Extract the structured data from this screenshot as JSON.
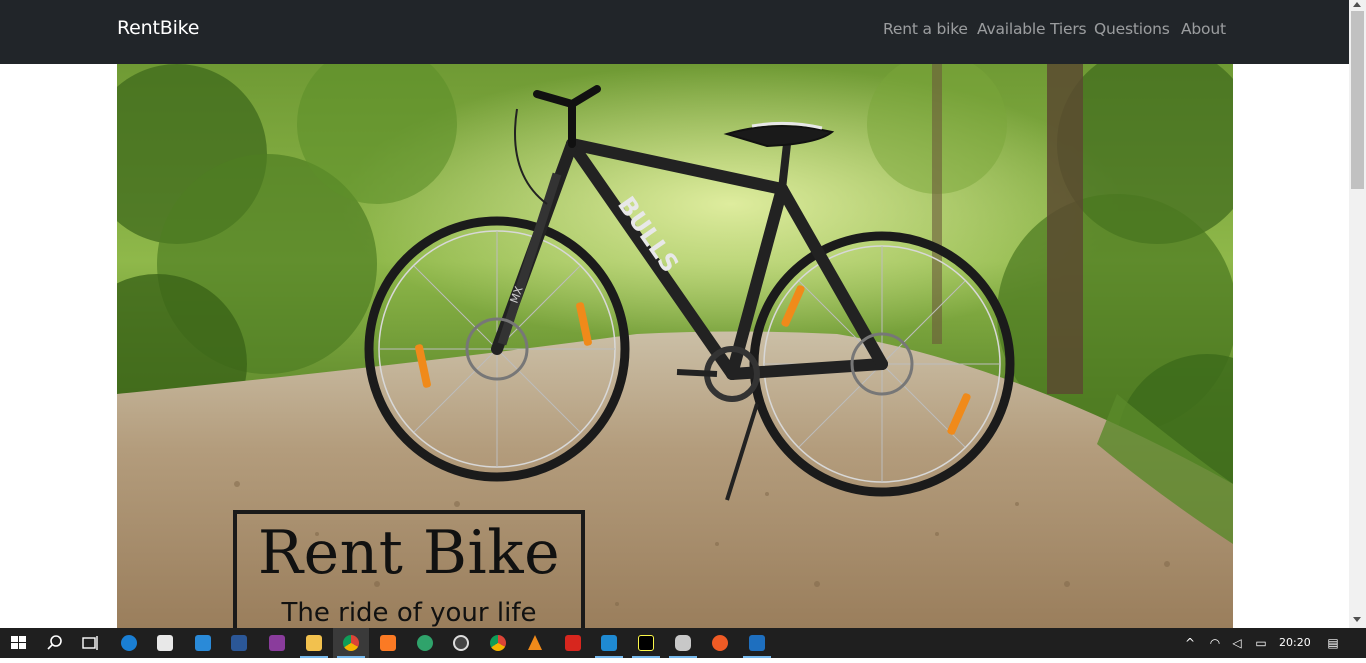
{
  "navbar": {
    "brand": "RentBike",
    "links": [
      "Rent a bike",
      "Available Tiers",
      "Questions",
      "About"
    ]
  },
  "hero": {
    "title": "Rent Bike",
    "subtitle": "The ride of your life",
    "bike_brand_text": "BULLS",
    "fork_text": "MX"
  },
  "taskbar": {
    "icons": [
      "windows-start-icon",
      "search-icon",
      "task-view-icon",
      "edge-icon",
      "store-icon",
      "mail-icon",
      "word-icon",
      "visual-studio-icon",
      "file-explorer-icon",
      "chrome-icon",
      "xampp-icon",
      "git-kraken-icon",
      "obs-icon",
      "chrome-alt-icon",
      "vlc-icon",
      "acrobat-icon",
      "vscode-icon",
      "pycharm-icon",
      "database-icon",
      "postman-icon",
      "photos-icon"
    ],
    "clock": "20:20"
  },
  "colors": {
    "navbar": "#212529",
    "nav_link": "rgba(255,255,255,0.55)",
    "taskbar": "#1f1f1f"
  }
}
